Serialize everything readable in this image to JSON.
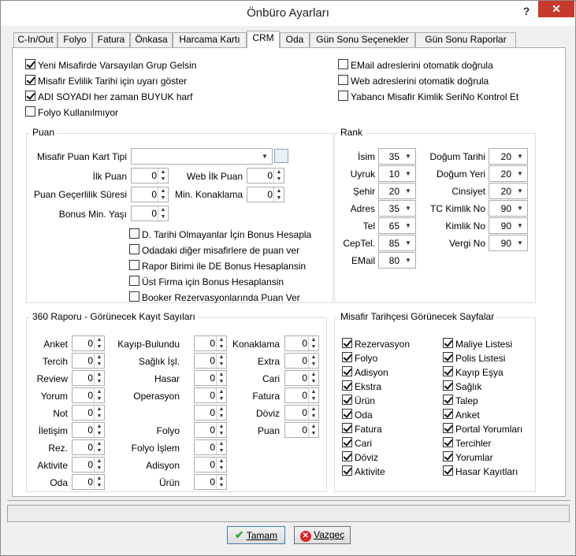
{
  "window": {
    "title": "Önbüro Ayarları",
    "help": "?",
    "close": "✕"
  },
  "tabs": [
    "C-In/Out",
    "Folyo",
    "Fatura",
    "Önkasa",
    "Harcama Kartı",
    "CRM",
    "Oda",
    "Gün Sonu Seçenekler",
    "Gün Sonu Raporlar"
  ],
  "active_tab": "CRM",
  "top_checks_left": [
    {
      "label": "Yeni Misafirde Varsayılan Grup Gelsin",
      "checked": true
    },
    {
      "label": "Misafir Evlilik Tarihi için uyarı göster",
      "checked": true
    },
    {
      "label": "ADI SOYADI her zaman BUYUK harf",
      "checked": true
    },
    {
      "label": "Folyo Kullanılmıyor",
      "checked": false
    }
  ],
  "top_checks_right": [
    {
      "label": "EMail adreslerini otomatik doğrula",
      "checked": false
    },
    {
      "label": "Web adreslerini otomatik doğrula",
      "checked": false
    },
    {
      "label": "Yabancı Misafir Kimlik SeriNo Kontrol Et",
      "checked": false
    }
  ],
  "puan": {
    "title": "Puan",
    "kart_tipi_label": "Misafir Puan Kart Tipi",
    "ilk_puan_label": "İlk Puan",
    "ilk_puan": "0",
    "web_ilk_puan_label": "Web İlk Puan",
    "web_ilk_puan": "0",
    "gecerlilik_label": "Puan Geçerlilik Süresi",
    "gecerlilik": "0",
    "min_konaklama_label": "Min. Konaklama",
    "min_konaklama": "0",
    "bonus_min_yasi_label": "Bonus Min.  Yaşı",
    "bonus_min_yasi": "0",
    "checks": [
      {
        "label": "D. Tarihi Olmayanlar İçin Bonus Hesapla",
        "checked": false
      },
      {
        "label": "Odadaki diğer misafirlere de puan ver",
        "checked": false
      },
      {
        "label": "Rapor Birimi ile DE Bonus Hesaplansin",
        "checked": false
      },
      {
        "label": "Üst Firma için Bonus Hesaplansin",
        "checked": false
      },
      {
        "label": "Booker Rezervasyonlarında Puan Ver",
        "checked": false
      }
    ]
  },
  "rank": {
    "title": "Rank",
    "left": [
      {
        "label": "İsim",
        "value": "35"
      },
      {
        "label": "Uyruk",
        "value": "10"
      },
      {
        "label": "Şehir",
        "value": "20"
      },
      {
        "label": "Adres",
        "value": "35"
      },
      {
        "label": "Tel",
        "value": "65"
      },
      {
        "label": "CepTel.",
        "value": "85"
      },
      {
        "label": "EMail",
        "value": "80"
      }
    ],
    "right": [
      {
        "label": "Doğum Tarihi",
        "value": "20"
      },
      {
        "label": "Doğum Yeri",
        "value": "20"
      },
      {
        "label": "Cinsiyet",
        "value": "20"
      },
      {
        "label": "TC Kimlik No",
        "value": "90"
      },
      {
        "label": "Kimlik No",
        "value": "90"
      },
      {
        "label": "Vergi No",
        "value": "90"
      }
    ]
  },
  "rapor360": {
    "title": "360 Raporu - Görünecek Kayıt Sayıları",
    "col1": [
      {
        "label": "Anket",
        "value": "0"
      },
      {
        "label": "Tercih",
        "value": "0"
      },
      {
        "label": "Review",
        "value": "0"
      },
      {
        "label": "Yorum",
        "value": "0"
      },
      {
        "label": "Not",
        "value": "0"
      },
      {
        "label": "İletişim",
        "value": "0"
      },
      {
        "label": "Rez.",
        "value": "0"
      },
      {
        "label": "Aktivite",
        "value": "0"
      },
      {
        "label": "Oda",
        "value": "0"
      }
    ],
    "col2": [
      {
        "label": "Kayıp-Bulundu",
        "value": "0"
      },
      {
        "label": "Sağlık İşl.",
        "value": "0"
      },
      {
        "label": "Hasar",
        "value": "0"
      },
      {
        "label": "Operasyon",
        "value": "0"
      },
      {
        "label": "",
        "value": "0"
      },
      {
        "label": "Folyo",
        "value": "0"
      },
      {
        "label": "Folyo İşlem",
        "value": "0"
      },
      {
        "label": "Adisyon",
        "value": "0"
      },
      {
        "label": "Ürün",
        "value": "0"
      }
    ],
    "col3": [
      {
        "label": "Konaklama",
        "value": "0"
      },
      {
        "label": "Extra",
        "value": "0"
      },
      {
        "label": "Cari",
        "value": "0"
      },
      {
        "label": "Fatura",
        "value": "0"
      },
      {
        "label": "Döviz",
        "value": "0"
      },
      {
        "label": "Puan",
        "value": "0"
      }
    ]
  },
  "tarihce": {
    "title": "Misafir Tarihçesi Görünecek Sayfalar",
    "left": [
      "Rezervasyon",
      "Folyo",
      "Adisyon",
      "Ekstra",
      "Ürün",
      "Oda",
      "Fatura",
      "Cari",
      "Döviz",
      "Aktivite"
    ],
    "right": [
      "Maliye Listesi",
      "Polis Listesi",
      "Kayıp Eşya",
      "Sağlık",
      "Talep",
      "Anket",
      "Portal Yorumları",
      "Tercihler",
      "Yorumlar",
      "Hasar Kayıtları"
    ]
  },
  "buttons": {
    "ok": "Tamam",
    "cancel": "Vazgeç"
  },
  "colors": {
    "close_bg": "#c7392b",
    "ok_icon": "#3aa83a",
    "cancel_icon": "#d22"
  }
}
